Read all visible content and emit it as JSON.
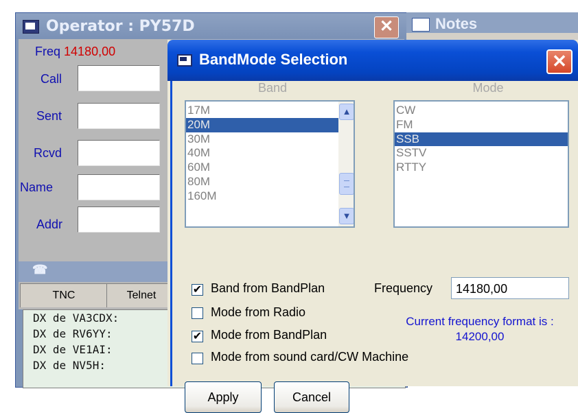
{
  "operator_window": {
    "title": "Operator : PY57D",
    "freq_label": "Freq",
    "freq_value": "14180,00",
    "fields": [
      "Call",
      "Sent",
      "Rcvd",
      "Name",
      "Addr"
    ],
    "tabs": [
      "TNC",
      "Telnet"
    ],
    "dx_lines": [
      "DX de VA3CDX:",
      "DX de RV6YY:",
      "DX de VE1AI:",
      "DX de NV5H:"
    ]
  },
  "notes_window": {
    "title": "Notes"
  },
  "dialog": {
    "title": "BandMode Selection",
    "band_header": "Band",
    "mode_header": "Mode",
    "bands": [
      "17M",
      "20M",
      "30M",
      "40M",
      "60M",
      "80M",
      "160M"
    ],
    "selected_band": "20M",
    "modes": [
      "CW",
      "FM",
      "SSB",
      "SSTV",
      "RTTY"
    ],
    "selected_mode": "SSB",
    "checkboxes": [
      {
        "label": "Band from BandPlan",
        "checked": true
      },
      {
        "label": "Mode from Radio",
        "checked": false
      },
      {
        "label": "Mode from BandPlan",
        "checked": true
      },
      {
        "label": "Mode from sound card/CW Machine",
        "checked": false
      }
    ],
    "frequency_label": "Frequency",
    "frequency_value": "14180,00",
    "format_note_line1": "Current frequency format is :",
    "format_note_line2": "14200,00",
    "apply_label": "Apply",
    "cancel_label": "Cancel"
  },
  "colors": {
    "titlebar": "#0a4fd6",
    "selection": "#2f5faa",
    "note_text": "#1414d0",
    "freq_red": "#d00000"
  }
}
